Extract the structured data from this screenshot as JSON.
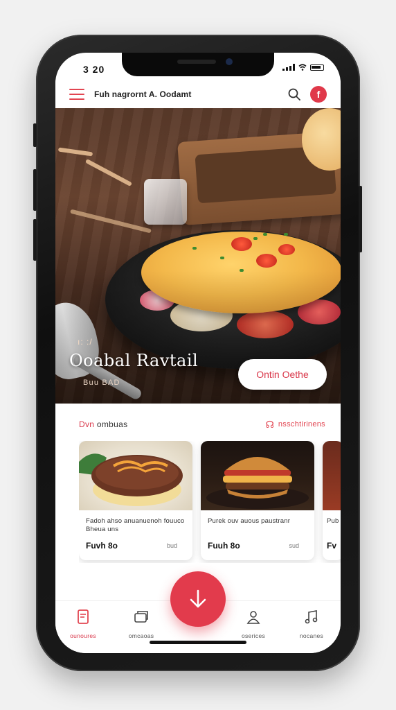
{
  "status_bar": {
    "time": "3 20"
  },
  "header": {
    "title": "Fuh nagrornt A. Oodamt",
    "profile_glyph": "f"
  },
  "hero": {
    "kicker": "ı: :/",
    "title": "Ooabal Ravtail",
    "subtitle": "Buu BAD",
    "cta_label": "Ontin Oethe"
  },
  "section": {
    "title_accent": "Dvn",
    "title_rest": " ombuas",
    "see_all_icon": "☊",
    "see_all_label": "nsschtirinens"
  },
  "cards": [
    {
      "name": "Fadoh ahso anuanuenoh fouuco Bheua uns",
      "price": "Fuvh 8o",
      "tag": "bud",
      "image": "steak"
    },
    {
      "name": "Purek ouv auous paustranr",
      "price": "Fuuh 8o",
      "tag": "sud",
      "image": "burger"
    },
    {
      "name": "Pub",
      "price": "Fv",
      "tag": "",
      "image": "third"
    }
  ],
  "bottom_nav": [
    {
      "label": "ounoures",
      "icon": "bookmark-icon",
      "active": true
    },
    {
      "label": "omcaoas",
      "icon": "cards-icon",
      "active": false
    },
    {
      "label": "oserices",
      "icon": "user-icon",
      "active": false
    },
    {
      "label": "nocanes",
      "icon": "music-icon",
      "active": false
    }
  ],
  "fab": {
    "icon": "arrow-down-icon"
  },
  "colors": {
    "accent": "#e23b4c",
    "text": "#222222",
    "background": "#ffffff"
  }
}
